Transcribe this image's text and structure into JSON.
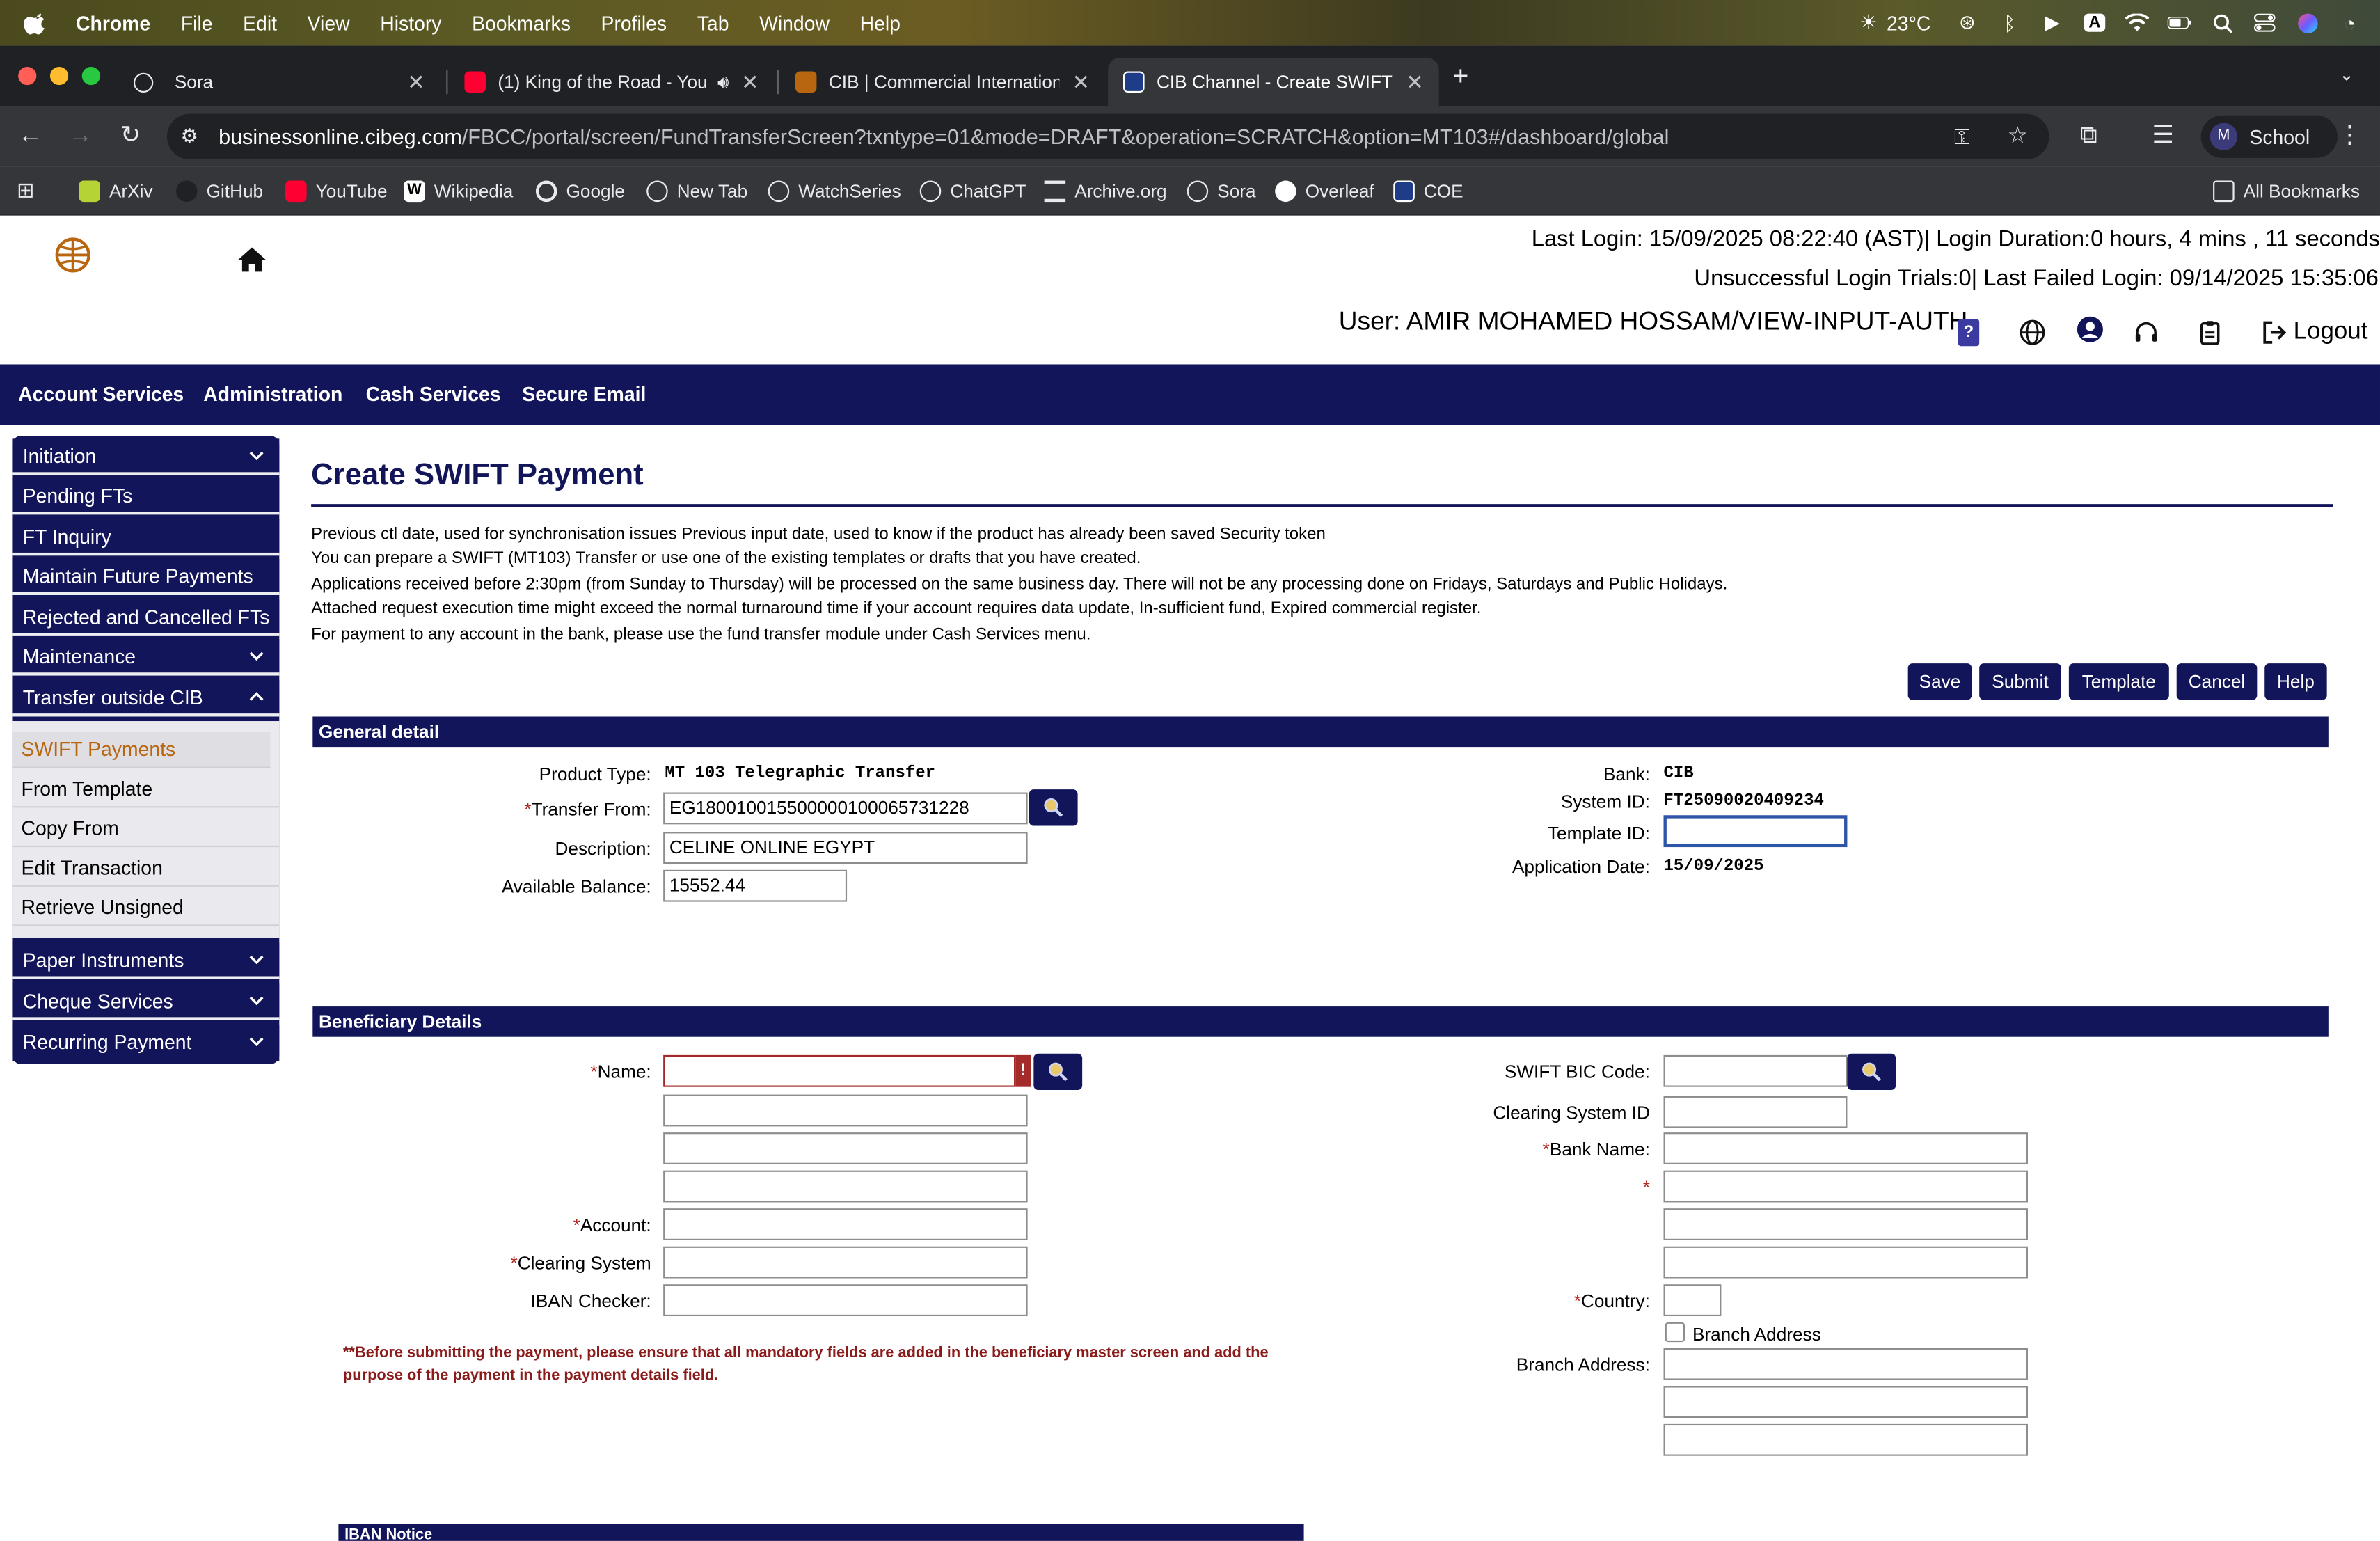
{
  "macos": {
    "menu": [
      "Chrome",
      "File",
      "Edit",
      "View",
      "History",
      "Bookmarks",
      "Profiles",
      "Tab",
      "Window",
      "Help"
    ],
    "weather": "23°C"
  },
  "tabs": [
    {
      "title": "Sora",
      "icon": "sora-icon"
    },
    {
      "title": "(1) King of the Road - You",
      "icon": "youtube-icon"
    },
    {
      "title": "CIB | Commercial Internationa",
      "icon": "cib-icon"
    },
    {
      "title": "CIB Channel - Create SWIFT P",
      "icon": "cib-channel-icon",
      "active": true
    }
  ],
  "address_bar": {
    "host": "businessonline.cibeg.com",
    "path": "/FBCC/portal/screen/FundTransferScreen?txntype=01&mode=DRAFT&operation=SCRATCH&option=MT103#/dashboard/global"
  },
  "profile": {
    "initial": "M",
    "label": "School"
  },
  "bookmarks": [
    "ArXiv",
    "GitHub",
    "YouTube",
    "Wikipedia",
    "Google",
    "New Tab",
    "WatchSeries",
    "ChatGPT",
    "Archive.org",
    "Sora",
    "Overleaf",
    "COE"
  ],
  "all_bookmarks": "All Bookmarks",
  "header": {
    "last_login": "Last Login: 15/09/2025 08:22:40 (AST)| Login Duration:0 hours, 4 mins , 11 seconds",
    "unsuccessful": "Unsuccessful Login Trials:0| Last Failed Login: 09/14/2025 15:35:06",
    "user": "User: AMIR MOHAMED HOSSAM/VIEW-INPUT-AUTH",
    "logout": "Logout",
    "help_mark": "?"
  },
  "nav": [
    "Account Services",
    "Administration",
    "Cash Services",
    "Secure Email"
  ],
  "sidebar": {
    "top_items": [
      "Initiation",
      "Pending FTs",
      "FT Inquiry",
      "Maintain Future Payments",
      "Rejected and Cancelled FTs",
      "Maintenance",
      "Transfer outside CIB"
    ],
    "sub_items": [
      "SWIFT Payments",
      "From Template",
      "Copy From",
      "Edit Transaction",
      "Retrieve Unsigned"
    ],
    "bottom_items": [
      "Paper Instruments",
      "Cheque Services",
      "Recurring Payment"
    ]
  },
  "page": {
    "title": "Create SWIFT Payment",
    "info": [
      "Previous ctl date, used for synchronisation issues Previous input date, used to know if the product has already been saved Security token",
      "You can prepare a SWIFT (MT103) Transfer or use one of the existing templates or drafts that you have created.",
      "Applications received before 2:30pm (from Sunday to Thursday) will be processed on the same business day. There will not be any processing done on Fridays, Saturdays and Public Holidays.",
      "Attached request execution time might exceed the normal turnaround time if your account requires data update, In-sufficient fund, Expired commercial register.",
      "For payment to any account in the bank, please use the fund transfer module under Cash Services menu."
    ],
    "buttons": {
      "save": "Save",
      "submit": "Submit",
      "template": "Template",
      "cancel": "Cancel",
      "help": "Help"
    }
  },
  "general": {
    "section": "General detail",
    "product_type_label": "Product Type:",
    "product_type": "MT 103 Telegraphic Transfer",
    "transfer_from_label": "Transfer From:",
    "transfer_from": "EG180010015500000100065731228",
    "description_label": "Description:",
    "description": "CELINE ONLINE EGYPT",
    "available_balance_label": "Available Balance:",
    "available_balance": "15552.44",
    "bank_label": "Bank:",
    "bank": "CIB",
    "system_id_label": "System ID:",
    "system_id": "FT25090020409234",
    "template_id_label": "Template ID:",
    "template_id": "",
    "application_date_label": "Application Date:",
    "application_date": "15/09/2025"
  },
  "beneficiary": {
    "section": "Beneficiary Details",
    "name_label": "Name:",
    "account_label": "Account:",
    "clearing_system_label": "Clearing System",
    "iban_checker_label": "IBAN Checker:",
    "swift_bic_label": "SWIFT BIC Code:",
    "clearing_system_id_label": "Clearing System ID",
    "bank_name_label": "Bank Name:",
    "country_label": "Country:",
    "branch_address_check": "Branch Address",
    "branch_address_label": "Branch Address:",
    "required_mark": "*",
    "error_mark": "!",
    "notice": "**Before submitting the payment, please ensure that all mandatory fields are added in the beneficiary master screen and add the purpose of the payment in the payment details field."
  },
  "iban_notice": "IBAN Notice"
}
